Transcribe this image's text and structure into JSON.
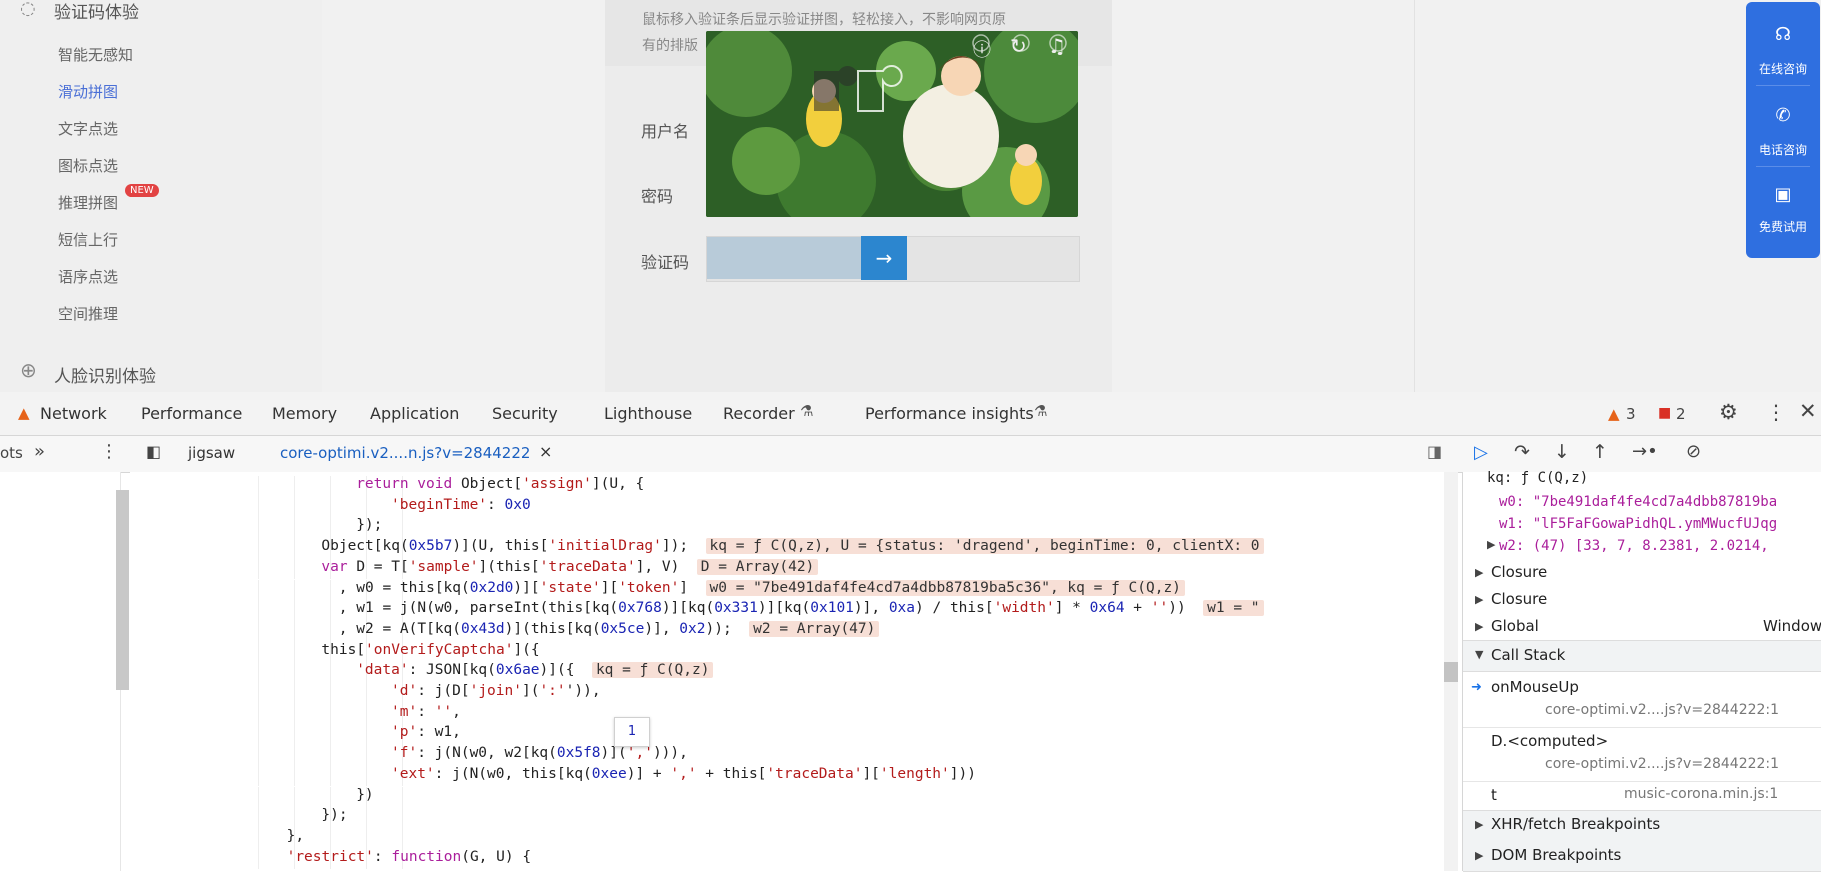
{
  "sidebar": {
    "section1": "验证码体验",
    "items": [
      "智能无感知",
      "滑动拼图",
      "文字点选",
      "图标点选",
      "推理拼图",
      "短信上行",
      "语序点选",
      "空间推理"
    ],
    "new_badge": "NEW",
    "section2": "人脸识别体验"
  },
  "form": {
    "desc_line1": "鼠标移入验证条后显示验证拼图，轻松接入，不影响网页原",
    "desc_line2": "有的排版",
    "label_user": "用户名",
    "label_pwd": "密码",
    "label_captcha": "验证码",
    "slider_arrow": "→"
  },
  "float_panel": {
    "online": "在线咨询",
    "phone": "电话咨询",
    "trial": "免费试用"
  },
  "devtools": {
    "tabs": [
      "Network",
      "Performance",
      "Memory",
      "Application",
      "Security",
      "Lighthouse",
      "Recorder",
      "Performance insights"
    ],
    "warn_count": "3",
    "error_count": "2",
    "file_tabs": [
      "ots",
      "jigsaw",
      "core-optimi.v2....n.js?v=2844222"
    ],
    "close_x": "×",
    "code_lines": [
      {
        "indent": 26,
        "parts": [
          [
            "kw",
            "return void "
          ],
          [
            "p",
            "Object["
          ],
          [
            "str",
            "'assign'"
          ],
          [
            "p",
            "](U, {"
          ]
        ]
      },
      {
        "indent": 30,
        "parts": [
          [
            "str",
            "'beginTime'"
          ],
          [
            "p",
            ": "
          ],
          [
            "num",
            "0x0"
          ]
        ]
      },
      {
        "indent": 26,
        "parts": [
          [
            "p",
            "});"
          ]
        ]
      },
      {
        "indent": 22,
        "parts": [
          [
            "p",
            "Object[kq("
          ],
          [
            "num",
            "0x5b7"
          ],
          [
            "p",
            ")](U, this["
          ],
          [
            "str",
            "'initialDrag'"
          ],
          [
            "p",
            "]);  "
          ]
        ],
        "val": "kq = ƒ C(Q,z), U = {status: 'dragend', beginTime: 0, clientX: 0"
      },
      {
        "indent": 22,
        "parts": [
          [
            "kw",
            "var "
          ],
          [
            "p",
            "D = T["
          ],
          [
            "str",
            "'sample'"
          ],
          [
            "p",
            "](this["
          ],
          [
            "str",
            "'traceData'"
          ],
          [
            "p",
            "], V)  "
          ]
        ],
        "val": "D = Array(42)"
      },
      {
        "indent": 24,
        "parts": [
          [
            "p",
            ", w0 = this[kq("
          ],
          [
            "num",
            "0x2d0"
          ],
          [
            "p",
            ")]["
          ],
          [
            "str",
            "'state'"
          ],
          [
            "p",
            "]["
          ],
          [
            "str",
            "'token'"
          ],
          [
            "p",
            "]  "
          ]
        ],
        "val": "w0 = \"7be491daf4fe4cd7a4dbb87819ba5c36\", kq = ƒ C(Q,z)"
      },
      {
        "indent": 24,
        "parts": [
          [
            "p",
            ", w1 = j(N(w0, parseInt(this[kq("
          ],
          [
            "num",
            "0x768"
          ],
          [
            "p",
            ")][kq("
          ],
          [
            "num",
            "0x331"
          ],
          [
            "p",
            ")][kq("
          ],
          [
            "num",
            "0x101"
          ],
          [
            "p",
            ")], "
          ],
          [
            "num",
            "0xa"
          ],
          [
            "p",
            ") / this["
          ],
          [
            "str",
            "'width'"
          ],
          [
            "p",
            "] * "
          ],
          [
            "num",
            "0x64"
          ],
          [
            "p",
            " + "
          ],
          [
            "str",
            "''"
          ],
          [
            "p",
            "))  "
          ]
        ],
        "val": "w1 = \""
      },
      {
        "indent": 24,
        "parts": [
          [
            "p",
            ", w2 = A(T[kq("
          ],
          [
            "num",
            "0x43d"
          ],
          [
            "p",
            ")](this[kq("
          ],
          [
            "num",
            "0x5ce"
          ],
          [
            "p",
            ")], "
          ],
          [
            "num",
            "0x2"
          ],
          [
            "p",
            "));  "
          ]
        ],
        "val": "w2 = Array(47)"
      },
      {
        "indent": 22,
        "parts": [
          [
            "p",
            "this"
          ],
          [
            "p",
            "["
          ],
          [
            "str",
            "'onVerifyCaptcha'"
          ],
          [
            "p",
            "]("
          ],
          [
            "p",
            "{"
          ]
        ]
      },
      {
        "indent": 26,
        "parts": [
          [
            "str",
            "'data'"
          ],
          [
            "p",
            ": JSON[kq("
          ],
          [
            "num",
            "0x6ae"
          ],
          [
            "p",
            ")]({  "
          ]
        ],
        "val": "kq = ƒ C(Q,z)"
      },
      {
        "indent": 30,
        "parts": [
          [
            "str",
            "'d'"
          ],
          [
            "p",
            ": j(D["
          ],
          [
            "str",
            "'join'"
          ],
          [
            "p",
            "]("
          ],
          [
            "str",
            "':'"
          ],
          [
            "p",
            "')),"
          ]
        ],
        "highlight": true
      },
      {
        "indent": 30,
        "parts": [
          [
            "str",
            "'m'"
          ],
          [
            "p",
            ": "
          ],
          [
            "str",
            "''"
          ],
          [
            "p",
            ","
          ]
        ]
      },
      {
        "indent": 30,
        "parts": [
          [
            "str",
            "'p'"
          ],
          [
            "p",
            ": w1,"
          ]
        ]
      },
      {
        "indent": 30,
        "parts": [
          [
            "str",
            "'f'"
          ],
          [
            "p",
            ": j(N(w0, w2[kq("
          ],
          [
            "num",
            "0x5f8"
          ],
          [
            "p",
            ")]("
          ],
          [
            "str",
            "','"
          ],
          [
            "p",
            "))),"
          ]
        ]
      },
      {
        "indent": 30,
        "parts": [
          [
            "str",
            "'ext'"
          ],
          [
            "p",
            ": j(N(w0, this[kq("
          ],
          [
            "num",
            "0xee"
          ],
          [
            "p",
            ")] + "
          ],
          [
            "str",
            "','"
          ],
          [
            "p",
            " + this["
          ],
          [
            "str",
            "'traceData'"
          ],
          [
            "p",
            "]["
          ],
          [
            "str",
            "'length'"
          ],
          [
            "p",
            "]))"
          ]
        ]
      },
      {
        "indent": 26,
        "parts": [
          [
            "p",
            "})"
          ]
        ]
      },
      {
        "indent": 22,
        "parts": [
          [
            "p",
            "});"
          ]
        ]
      },
      {
        "indent": 18,
        "parts": [
          [
            "p",
            "},"
          ]
        ]
      },
      {
        "indent": 18,
        "parts": [
          [
            "str",
            "'restrict'"
          ],
          [
            "p",
            ": "
          ],
          [
            "kw",
            "function"
          ],
          [
            "p",
            "(G, U) {"
          ]
        ]
      }
    ],
    "hover_tooltip": "1",
    "scope": {
      "kq_line": "kq: ƒ C(Q,z)",
      "w0_line": "w0: \"7be491daf4fe4cd7a4dbb87819ba",
      "w1_line": "w1: \"lF5FaFGowaPidhQL.ymMWucfUJqg",
      "w2_line": "w2: (47) [33, 7, 8.2381, 2.0214,",
      "closure1": "Closure",
      "closure2": "Closure",
      "global": "Global",
      "global_val": "Window"
    },
    "call_stack": {
      "title": "Call Stack",
      "frames": [
        {
          "fn": "onMouseUp",
          "loc": "core-optimi.v2....js?v=2844222:1"
        },
        {
          "fn": "D.<computed>",
          "loc": "core-optimi.v2....js?v=2844222:1"
        },
        {
          "fn": "t",
          "loc": "music-corona.min.js:1"
        }
      ]
    },
    "xhr_bp": "XHR/fetch Breakpoints",
    "dom_bp": "DOM Breakpoints"
  }
}
